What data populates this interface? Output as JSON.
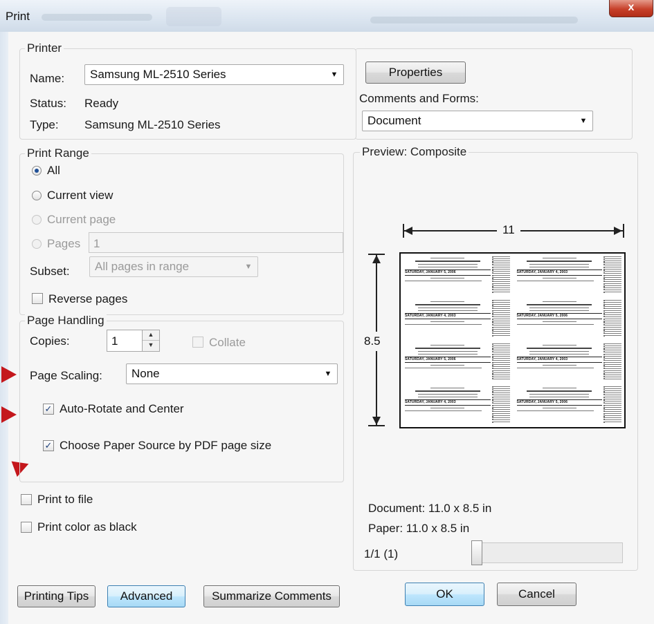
{
  "window": {
    "title": "Print",
    "close_glyph": "x"
  },
  "printer": {
    "legend": "Printer",
    "name_label": "Name:",
    "name_value": "Samsung ML-2510 Series",
    "status_label": "Status:",
    "status_value": "Ready",
    "type_label": "Type:",
    "type_value": "Samsung ML-2510 Series",
    "properties_button": "Properties",
    "comments_label": "Comments and Forms:",
    "comments_value": "Document"
  },
  "print_range": {
    "legend": "Print Range",
    "all": "All",
    "current_view": "Current view",
    "current_page": "Current page",
    "pages": "Pages",
    "pages_value": "1",
    "subset_label": "Subset:",
    "subset_value": "All pages in range",
    "reverse_pages": "Reverse pages",
    "selected": "All"
  },
  "page_handling": {
    "legend": "Page Handling",
    "copies_label": "Copies:",
    "copies_value": "1",
    "collate": "Collate",
    "scaling_label": "Page Scaling:",
    "scaling_value": "None",
    "auto_rotate": "Auto-Rotate and Center",
    "auto_rotate_checked": true,
    "paper_source": "Choose Paper Source by PDF page size",
    "paper_source_checked": true
  },
  "options": {
    "print_to_file": "Print to file",
    "print_color_black": "Print color as black"
  },
  "preview": {
    "legend": "Preview: Composite",
    "width_label": "11",
    "height_label": "8.5",
    "document_size": "Document: 11.0 x 8.5 in",
    "paper_size": "Paper: 11.0 x 8.5 in",
    "page_counter": "1/1 (1)",
    "ticket_date_a": "SATURDAY, JANUARY 5, 2006",
    "ticket_date_b": "SATURDAY, JANUARY 4, 2003"
  },
  "buttons": {
    "printing_tips": "Printing Tips",
    "advanced": "Advanced",
    "summarize": "Summarize Comments",
    "ok": "OK",
    "cancel": "Cancel"
  },
  "colors": {
    "accent_focus": "#3c7fb1",
    "annotation_arrow": "#c4171c",
    "close_button": "#c7402a"
  }
}
